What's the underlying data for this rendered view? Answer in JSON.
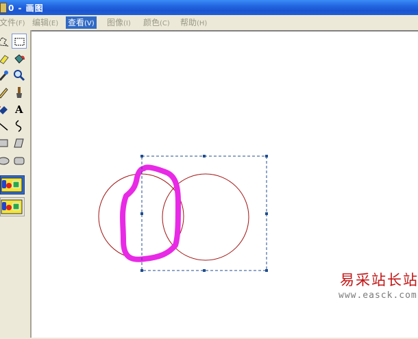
{
  "window": {
    "title": "0 - 画图"
  },
  "menu": {
    "items": [
      {
        "label": "文件",
        "accel": "(F)",
        "state": "disabled"
      },
      {
        "label": "编辑",
        "accel": "(E)",
        "state": "disabled"
      },
      {
        "label": "查看",
        "accel": "(V)",
        "state": "active"
      },
      {
        "label": "图像",
        "accel": "(I)",
        "state": "disabled"
      },
      {
        "label": "颜色",
        "accel": "(C)",
        "state": "disabled"
      },
      {
        "label": "帮助",
        "accel": "(H)",
        "state": "disabled"
      }
    ]
  },
  "toolbox": {
    "tools": [
      {
        "name": "free-form-select-icon"
      },
      {
        "name": "rectangle-select-icon",
        "selected": true
      },
      {
        "name": "eraser-icon"
      },
      {
        "name": "fill-bucket-icon"
      },
      {
        "name": "pick-color-icon"
      },
      {
        "name": "magnifier-icon"
      },
      {
        "name": "pencil-icon"
      },
      {
        "name": "brush-icon"
      },
      {
        "name": "airbrush-icon"
      },
      {
        "name": "text-icon",
        "glyph": "A"
      },
      {
        "name": "line-icon"
      },
      {
        "name": "curve-icon"
      },
      {
        "name": "rectangle-icon"
      },
      {
        "name": "polygon-icon"
      },
      {
        "name": "ellipse-icon"
      },
      {
        "name": "rounded-rectangle-icon"
      }
    ],
    "options": [
      {
        "name": "opaque-selection-option-icon",
        "selected": true
      },
      {
        "name": "transparent-selection-option-icon",
        "selected": false
      }
    ]
  },
  "colors": {
    "title_bar": "#2266e0",
    "menu_highlight": "#316ac5",
    "circle_stroke": "#a01010",
    "magenta_stroke": "#e82ae6",
    "selection_border": "#1f4d8f",
    "watermark_red": "#c21515"
  },
  "canvas": {
    "drawing": "two overlapping red circles with a magenta free-hand stroke and a dashed rectangular selection"
  },
  "watermark": {
    "text_cn": "易采站长站",
    "url": "www.easck.com"
  }
}
